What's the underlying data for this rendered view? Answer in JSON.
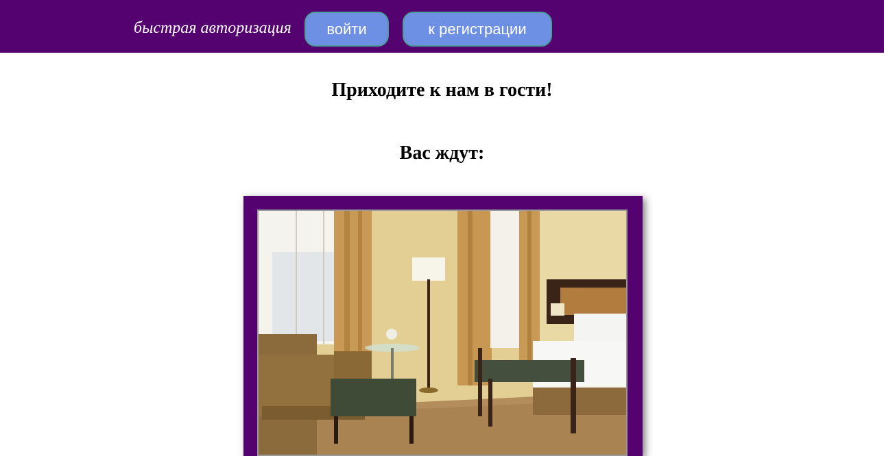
{
  "header": {
    "quick_auth_label": "быстрая авторизация",
    "login_button": "войти",
    "register_button": "к регистрации",
    "background_color": "#530270",
    "button_color": "#6d8fe4"
  },
  "main": {
    "welcome_heading": "Приходите к нам в гости!",
    "waiting_heading": "Вас ждут:"
  },
  "gallery": {
    "frame_color": "#530270",
    "image": "hotel-room-photo"
  }
}
